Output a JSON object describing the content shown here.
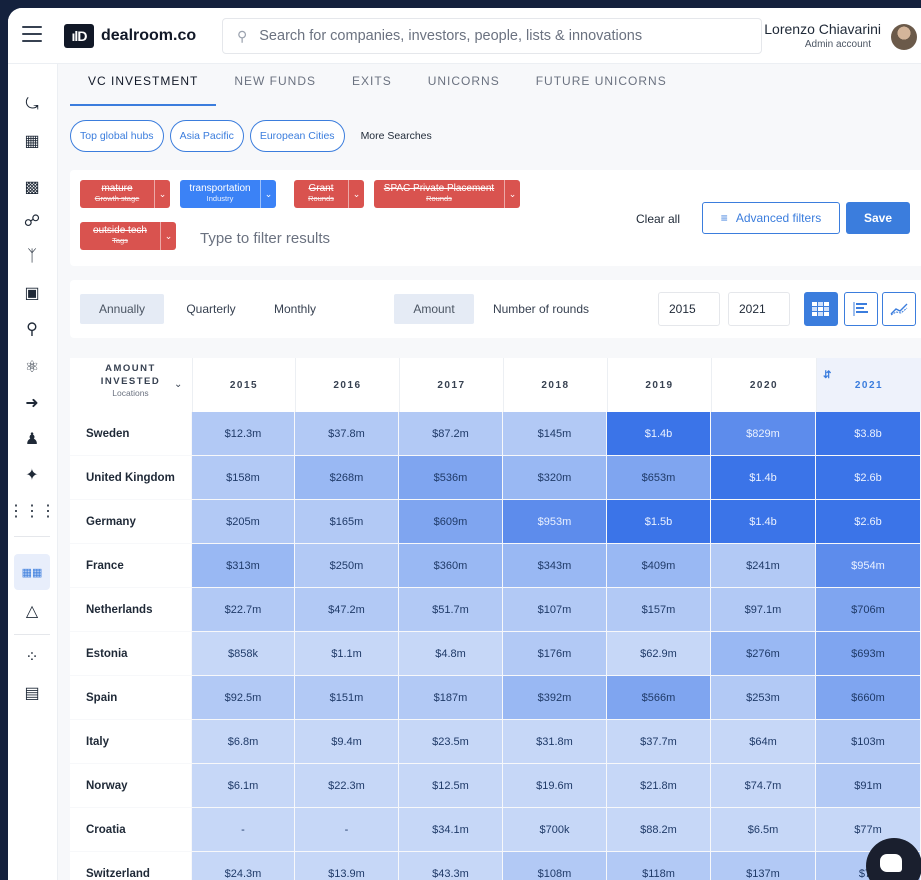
{
  "brand": {
    "mark": "ılD",
    "name": "dealroom.co"
  },
  "search": {
    "placeholder": "Search for companies, investors, people, lists & innovations"
  },
  "user": {
    "name": "Lorenzo Chiavarini",
    "role": "Admin account"
  },
  "tabs": [
    {
      "label": "VC INVESTMENT",
      "active": true
    },
    {
      "label": "NEW FUNDS",
      "active": false
    },
    {
      "label": "EXITS",
      "active": false
    },
    {
      "label": "UNICORNS",
      "active": false
    },
    {
      "label": "FUTURE UNICORNS",
      "active": false
    }
  ],
  "saved_searches": [
    "Top global hubs",
    "Asia Pacific",
    "European Cities"
  ],
  "more_searches": "More Searches",
  "filters": [
    {
      "value": "mature",
      "type": "Growth stage",
      "excluded": true
    },
    {
      "value": "transportation",
      "type": "Industry",
      "excluded": false
    },
    {
      "value": "Grant",
      "type": "Rounds",
      "excluded": true
    },
    {
      "value": "SPAC Private Placement",
      "type": "Rounds",
      "excluded": true
    },
    {
      "value": "outside tech",
      "type": "Tags",
      "excluded": true
    }
  ],
  "filter_input_placeholder": "Type to filter results",
  "clear_all": "Clear all",
  "advanced_filters": "Advanced filters",
  "save": "Save",
  "period": {
    "options": [
      "Annually",
      "Quarterly",
      "Monthly"
    ],
    "selected": "Annually"
  },
  "measure": {
    "options": [
      "Amount",
      "Number of rounds"
    ],
    "selected": "Amount"
  },
  "year_from": "2015",
  "year_to": "2021",
  "view_modes": {
    "selected": "heatmap"
  },
  "table": {
    "header": {
      "line1": "AMOUNT",
      "line2": "INVESTED",
      "sub": "Locations"
    },
    "years": [
      "2015",
      "2016",
      "2017",
      "2018",
      "2019",
      "2020",
      "2021"
    ],
    "sorted_column": "2021",
    "rows": [
      {
        "location": "Sweden",
        "values": [
          "$12.3m",
          "$37.8m",
          "$87.2m",
          "$145m",
          "$1.4b",
          "$829m",
          "$3.8b"
        ],
        "levels": [
          1,
          1,
          1,
          1,
          5,
          4,
          5
        ]
      },
      {
        "location": "United Kingdom",
        "values": [
          "$158m",
          "$268m",
          "$536m",
          "$320m",
          "$653m",
          "$1.4b",
          "$2.6b"
        ],
        "levels": [
          1,
          2,
          3,
          2,
          3,
          5,
          5
        ]
      },
      {
        "location": "Germany",
        "values": [
          "$205m",
          "$165m",
          "$609m",
          "$953m",
          "$1.5b",
          "$1.4b",
          "$2.6b"
        ],
        "levels": [
          1,
          1,
          3,
          4,
          5,
          5,
          5
        ]
      },
      {
        "location": "France",
        "values": [
          "$313m",
          "$250m",
          "$360m",
          "$343m",
          "$409m",
          "$241m",
          "$954m"
        ],
        "levels": [
          2,
          1,
          2,
          2,
          2,
          1,
          4
        ]
      },
      {
        "location": "Netherlands",
        "values": [
          "$22.7m",
          "$47.2m",
          "$51.7m",
          "$107m",
          "$157m",
          "$97.1m",
          "$706m"
        ],
        "levels": [
          1,
          1,
          1,
          1,
          1,
          1,
          3
        ]
      },
      {
        "location": "Estonia",
        "values": [
          "$858k",
          "$1.1m",
          "$4.8m",
          "$176m",
          "$62.9m",
          "$276m",
          "$693m"
        ],
        "levels": [
          0,
          0,
          0,
          1,
          0,
          2,
          3
        ]
      },
      {
        "location": "Spain",
        "values": [
          "$92.5m",
          "$151m",
          "$187m",
          "$392m",
          "$566m",
          "$253m",
          "$660m"
        ],
        "levels": [
          1,
          1,
          1,
          2,
          3,
          1,
          3
        ]
      },
      {
        "location": "Italy",
        "values": [
          "$6.8m",
          "$9.4m",
          "$23.5m",
          "$31.8m",
          "$37.7m",
          "$64m",
          "$103m"
        ],
        "levels": [
          0,
          0,
          0,
          0,
          0,
          0,
          1
        ]
      },
      {
        "location": "Norway",
        "values": [
          "$6.1m",
          "$22.3m",
          "$12.5m",
          "$19.6m",
          "$21.8m",
          "$74.7m",
          "$91m"
        ],
        "levels": [
          0,
          0,
          0,
          0,
          0,
          0,
          1
        ]
      },
      {
        "location": "Croatia",
        "values": [
          "-",
          "-",
          "$34.1m",
          "$700k",
          "$88.2m",
          "$6.5m",
          "$77m"
        ],
        "levels": [
          0,
          0,
          0,
          0,
          0,
          0,
          0
        ]
      },
      {
        "location": "Switzerland",
        "values": [
          "$24.3m",
          "$13.9m",
          "$43.3m",
          "$108m",
          "$118m",
          "$137m",
          "$73"
        ],
        "levels": [
          0,
          0,
          0,
          1,
          1,
          1,
          1
        ]
      }
    ]
  },
  "colors": {
    "accent": "#3b7ddd",
    "excluded_filter": "#d9534f",
    "included_filter": "#3b82f6",
    "heat": [
      "#c6d7f7",
      "#b2c9f5",
      "#99b8f3",
      "#7fa5f0",
      "#5d8cec",
      "#3b74e8"
    ]
  }
}
